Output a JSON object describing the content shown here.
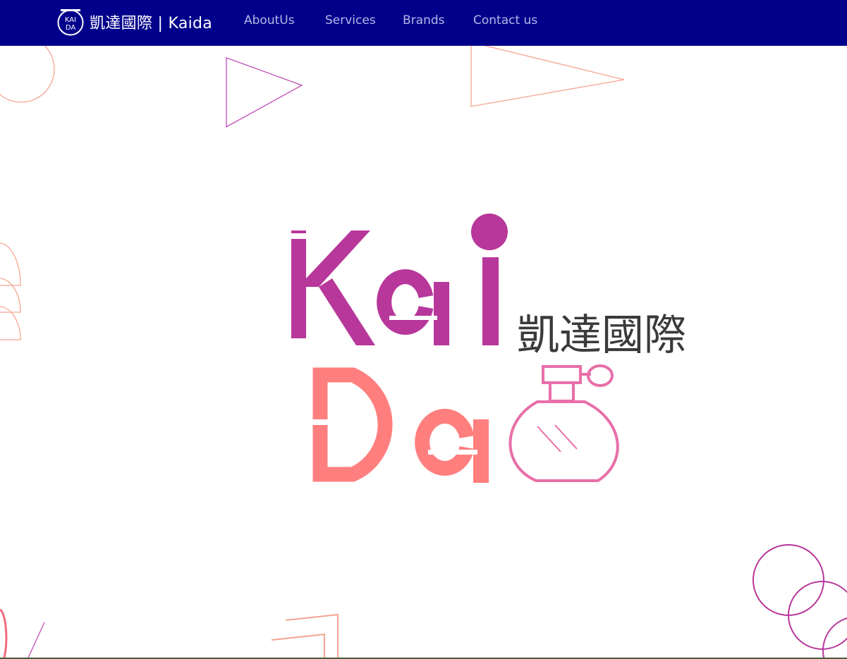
{
  "header": {
    "brand": {
      "logo_text_top": "KAI",
      "logo_text_bottom": "DA",
      "text": "凱達國際 | Kaida"
    },
    "nav": [
      {
        "label": "AboutUs"
      },
      {
        "label": "Services"
      },
      {
        "label": "Brands"
      },
      {
        "label": "Contact us"
      }
    ]
  },
  "hero": {
    "logo": {
      "word_top": "Kai",
      "word_bottom": "Da",
      "chinese": "凱達國際",
      "icon": "perfume-bottle-icon"
    }
  },
  "colors": {
    "navbar": "#00008b",
    "nav_link": "#b7b7e6",
    "magenta": "#b7379a",
    "coral": "#ff7f7f",
    "pink": "#e86fa8",
    "dark_text": "#3a3a3a",
    "outline_peach": "#f4a592",
    "outline_purple": "#c04fb9"
  }
}
